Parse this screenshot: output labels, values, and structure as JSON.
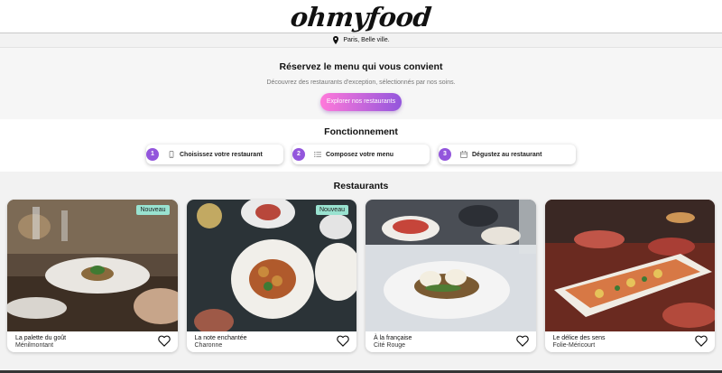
{
  "header": {
    "logo": "ohmyfood"
  },
  "location": {
    "text": "Paris, Belle ville.",
    "icon": "map-pin-icon"
  },
  "hero": {
    "title": "Réservez le menu qui vous convient",
    "subtitle": "Découvrez des restaurants d'exception, sélectionnés par nos soins.",
    "cta_label": "Explorer nos restaurants",
    "cta_gradient": [
      "#ff79da",
      "#9356dc"
    ]
  },
  "how": {
    "title": "Fonctionnement",
    "steps": [
      {
        "number": "1",
        "label": "Choisissez votre restaurant",
        "icon": "mobile-phone-icon"
      },
      {
        "number": "2",
        "label": "Composez votre menu",
        "icon": "list-icon"
      },
      {
        "number": "3",
        "label": "Dégustez au restaurant",
        "icon": "calendar-icon"
      }
    ],
    "accent": "#9356dc"
  },
  "restaurants": {
    "title": "Restaurants",
    "badge_color": "#99e2d0",
    "items": [
      {
        "name": "La palette du goût",
        "area": "Ménilmontant",
        "badge": "Nouveau"
      },
      {
        "name": "La note enchantée",
        "area": "Charonne",
        "badge": "Nouveau"
      },
      {
        "name": "À la française",
        "area": "Cité Rouge",
        "badge": ""
      },
      {
        "name": "Le délice des sens",
        "area": "Folie-Méricourt",
        "badge": ""
      }
    ]
  }
}
